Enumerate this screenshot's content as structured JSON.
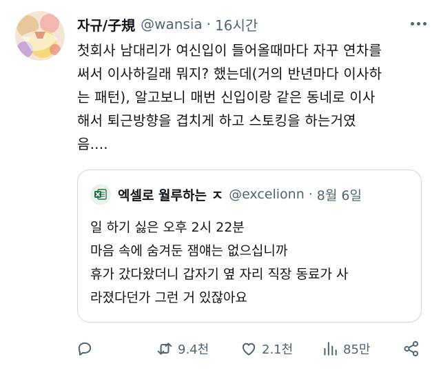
{
  "tweet": {
    "display_name": "자규/子規",
    "handle": "@wansia",
    "separator": "·",
    "time": "16시간",
    "text": "첫회사 남대리가 여신입이 들어올때마다 자꾸 연차를\n써서 이사하길래 뭐지? 했는데(거의 반년마다 이사하\n는 패턴), 알고보니 매번 신입이랑 같은 동네로 이사\n해서 퇴근방향을 겹치게 하고 스토킹을 하는거였\n음...."
  },
  "quote": {
    "display_name": "엑셀로 월루하는 ㅈ",
    "handle": "@excelionn",
    "separator": "·",
    "date": "8월 6일",
    "text": "일 하기 싫은 오후 2시 22분\n마음 속에 숨겨둔 잼얘는 없으십니까\n휴가 갔다왔더니 갑자기 옆 자리 직장 동료가 사\n라졌다던가 그런 거 있잖아요"
  },
  "actions": {
    "retweet_count": "9.4천",
    "like_count": "2.1천",
    "view_count": "85만"
  },
  "colors": {
    "text": "#0f1419",
    "secondary": "#536471",
    "border": "#cfd9de",
    "excel_green": "#1f7244"
  },
  "icons": {
    "reply": "speech-bubble",
    "retweet": "two-arrows-loop",
    "like": "heart-outline",
    "views": "bar-chart",
    "share": "share-nodes",
    "more": "three-dots"
  }
}
